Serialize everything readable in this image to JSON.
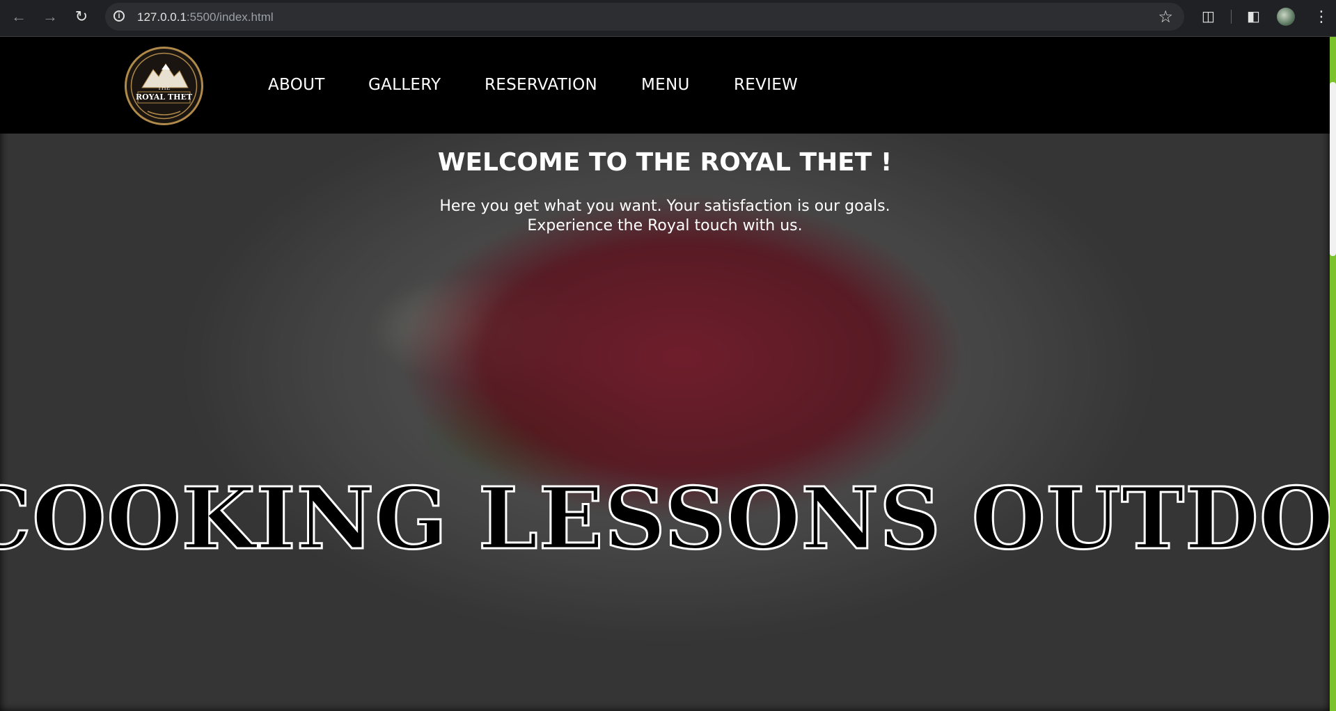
{
  "browser": {
    "url_host": "127.0.0.1",
    "url_rest": ":5500/index.html",
    "back_icon": "arrow-left-icon",
    "forward_icon": "arrow-right-icon",
    "reload_icon": "reload-icon"
  },
  "logo": {
    "text_top": "THE",
    "text_main": "ROYAL THET"
  },
  "nav": {
    "items": [
      "ABOUT",
      "GALLERY",
      "RESERVATION",
      "MENU",
      "REVIEW"
    ]
  },
  "hero": {
    "title": "WELCOME TO THE ROYAL THET !",
    "subtitle_line1": "Here you get what you want. Your satisfaction is our goals.",
    "subtitle_line2": "Experience the Royal touch with us.",
    "marquee": "COOKING LESSONS OUTDO"
  },
  "colors": {
    "scrollbar_accent": "#7cc22c",
    "logo_gold": "#b08a4a"
  }
}
